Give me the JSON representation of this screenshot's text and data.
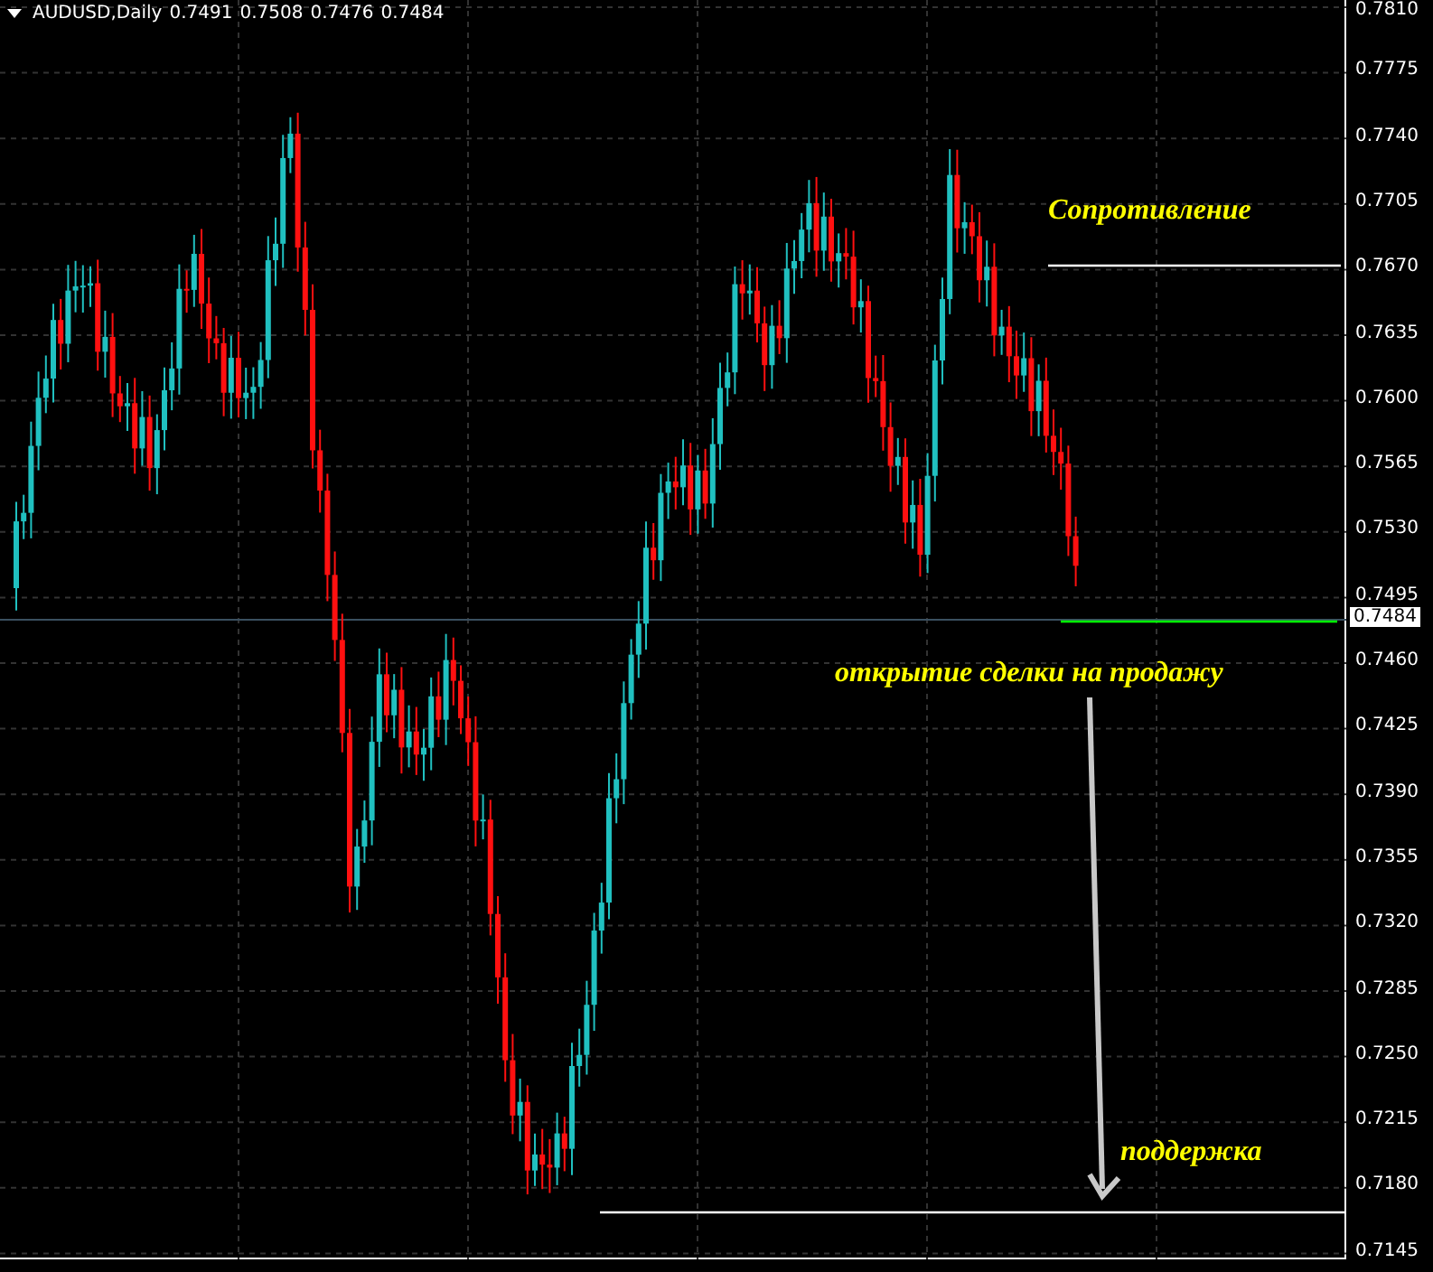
{
  "header": {
    "symbol": "AUDUSD,Daily",
    "ohlc": [
      "0.7491",
      "0.7508",
      "0.7476",
      "0.7484"
    ]
  },
  "price_axis": {
    "ticks": [
      "0.7810",
      "0.7775",
      "0.7740",
      "0.7705",
      "0.7670",
      "0.7635",
      "0.7600",
      "0.7565",
      "0.7530",
      "0.7495",
      "0.7460",
      "0.7425",
      "0.7390",
      "0.7355",
      "0.7320",
      "0.7285",
      "0.7250",
      "0.7215",
      "0.7180",
      "0.7145"
    ],
    "current_price": "0.7484"
  },
  "annotations": [
    {
      "kind": "resistance",
      "label": "Сопротивление"
    },
    {
      "kind": "entry",
      "label": "открытие сделки на продажу"
    },
    {
      "kind": "support",
      "label": "поддержка"
    }
  ]
}
